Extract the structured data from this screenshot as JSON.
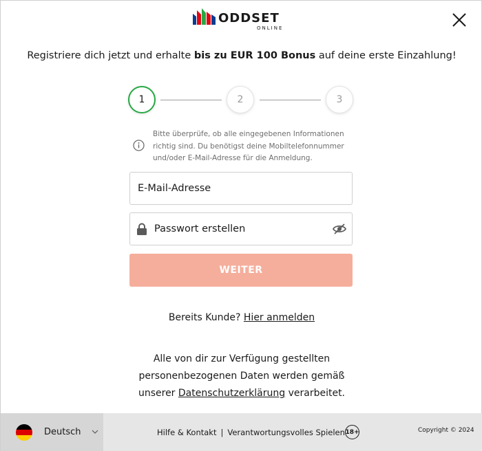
{
  "header": {
    "logo_word": "ODDSET",
    "logo_sub": "ONLINE",
    "logo_colors": [
      "#0a3d91",
      "#e30613",
      "#27a844",
      "#e30613",
      "#0a3d91"
    ],
    "close_icon": "close-icon"
  },
  "promo": {
    "prefix": "Registriere dich jetzt und erhalte ",
    "highlight": "bis zu EUR 100 Bonus",
    "suffix": " auf deine erste Einzahlung!"
  },
  "stepper": {
    "steps": [
      "1",
      "2",
      "3"
    ],
    "active_step": 1,
    "active_color": "#27a844"
  },
  "info": {
    "icon": "info-icon",
    "text": "Bitte überprüfe, ob alle eingegebenen Informationen richtig sind. Du benötigst deine Mobiltelefonnummer und/oder E-Mail-Adresse für die Anmeldung."
  },
  "form": {
    "email": {
      "placeholder": "E-Mail-Adresse",
      "value": ""
    },
    "password": {
      "placeholder": "Passwort erstellen",
      "value": "",
      "lock_icon": "lock-icon",
      "toggle_icon": "eye-slash-icon"
    },
    "submit_label": "WEITER",
    "submit_color": "#f5ae9c"
  },
  "login": {
    "prefix": "Bereits Kunde? ",
    "link": "Hier anmelden"
  },
  "privacy": {
    "prefix": "Alle von dir zur Verfügung gestellten personenbezogenen Daten werden gemäß unserer ",
    "link": "Datenschutzerklärung",
    "suffix": " verarbeitet."
  },
  "footer": {
    "language": "Deutsch",
    "flag_icon": "germany-flag-icon",
    "links": [
      "Hilfe & Kontakt",
      "Verantwortungsvolles Spielen"
    ],
    "separator": "|",
    "age_badge": "18+",
    "copyright": "Copyright © 2024"
  }
}
